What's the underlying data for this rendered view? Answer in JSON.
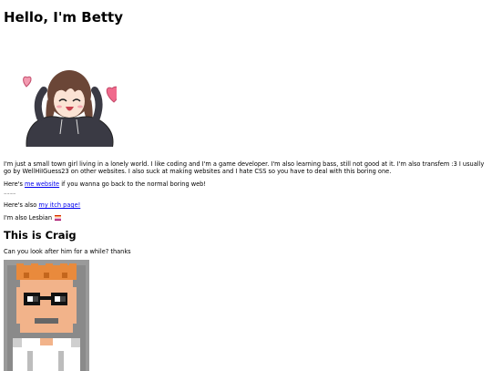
{
  "page": {
    "heading": "Hello, I'm Betty",
    "bio": "I'm just a small town girl living in a lonely world. I like coding and I'm a game developer. I'm also learning bass, still not good at it. I'm also transfem :3 I usually go by WellHiIGuess23 on other websites. I also suck at making websites and I hate CSS so you have to deal with this boring one.",
    "website_line": {
      "before": "Here's ",
      "link": "me website",
      "after": " if you wanna go back to the normal boring web!"
    },
    "separator": "~~~~",
    "itch_line": {
      "before": "Here's also ",
      "link": "my itch page!"
    },
    "lesbian_line": "I'm also Lesbian",
    "craig_heading": "This is Craig",
    "craig_text": "Can you look after him for a while? thanks"
  },
  "icons": {
    "avatar": "anime-girl-hoodie-hearts",
    "flag": "lesbian-pride-flag-icon",
    "craig": "pixel-art-craig"
  },
  "colors": {
    "link": "#0000ee",
    "heart": "#f06a8c",
    "hoodie": "#3a3a44",
    "hair": "#6b4637",
    "craig_hair": "#e98a3c",
    "craig_skin": "#f2b38a"
  }
}
